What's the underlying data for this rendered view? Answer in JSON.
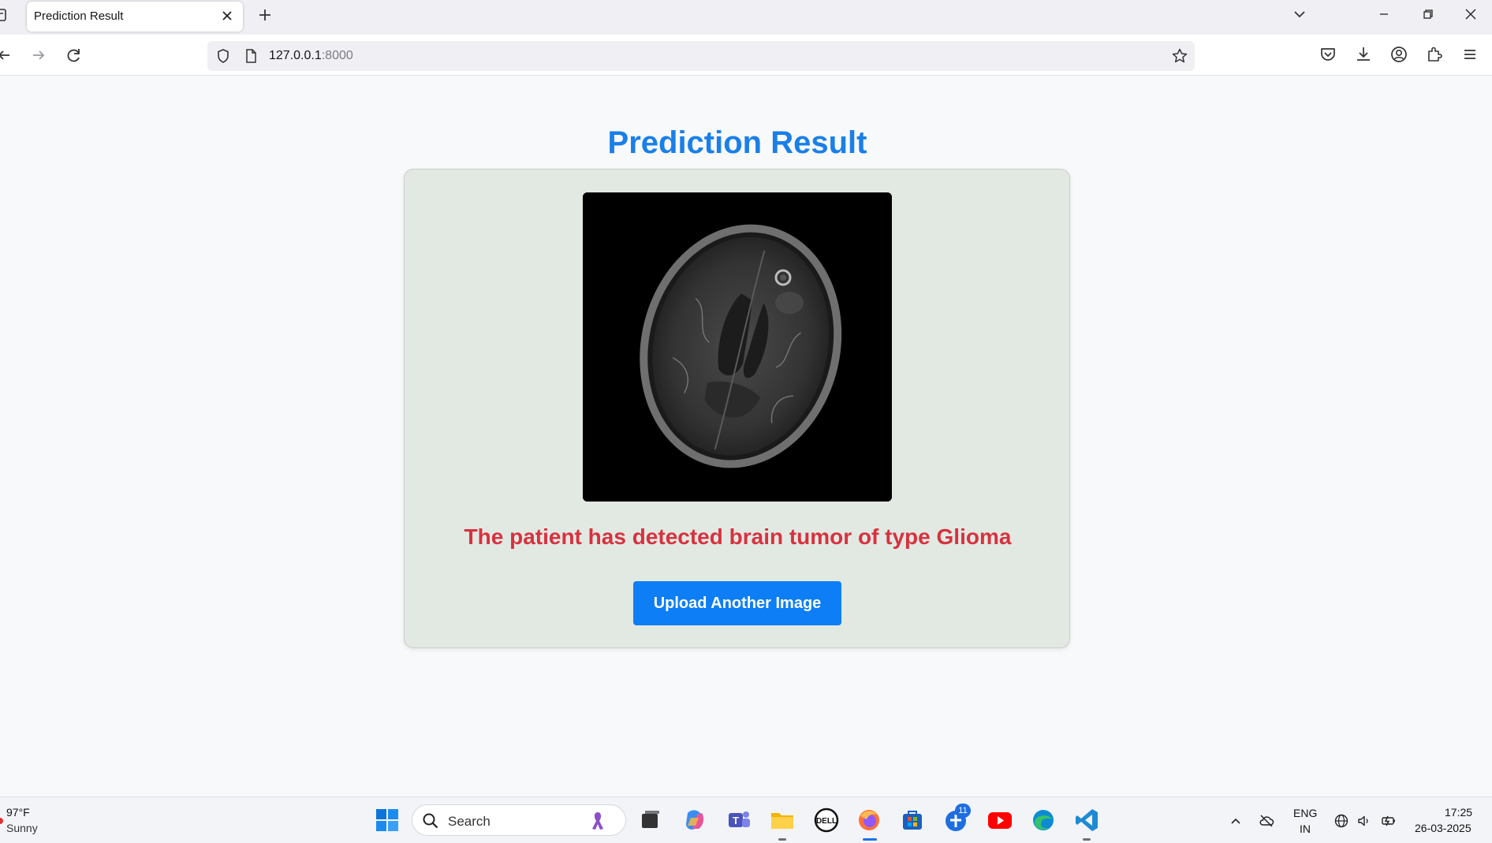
{
  "browser": {
    "tab_title": "Prediction Result",
    "url_host": "127.0.0.1",
    "url_port": ":8000"
  },
  "page": {
    "title": "Prediction Result",
    "result_prefix": "The patient has detected brain tumor of type ",
    "tumor_type": "Glioma",
    "upload_button": "Upload Another Image",
    "colors": {
      "title": "#1a7fe8",
      "result": "#d7323f",
      "button": "#0d7ef5",
      "card": "#e2e9e3"
    }
  },
  "taskbar": {
    "weather_temp": "97°F",
    "weather_condition": "Sunny",
    "search_placeholder": "Search",
    "notification_badge": "11",
    "language_top": "ENG",
    "language_bottom": "IN",
    "time": "17:25",
    "date": "26-03-2025",
    "apps": [
      "start-icon",
      "file-explorer-icon",
      "copilot-icon",
      "teams-icon",
      "folder-icon",
      "dell-icon",
      "firefox-icon",
      "store-icon",
      "app-icon",
      "youtube-icon",
      "edge-icon",
      "vscode-icon"
    ]
  }
}
